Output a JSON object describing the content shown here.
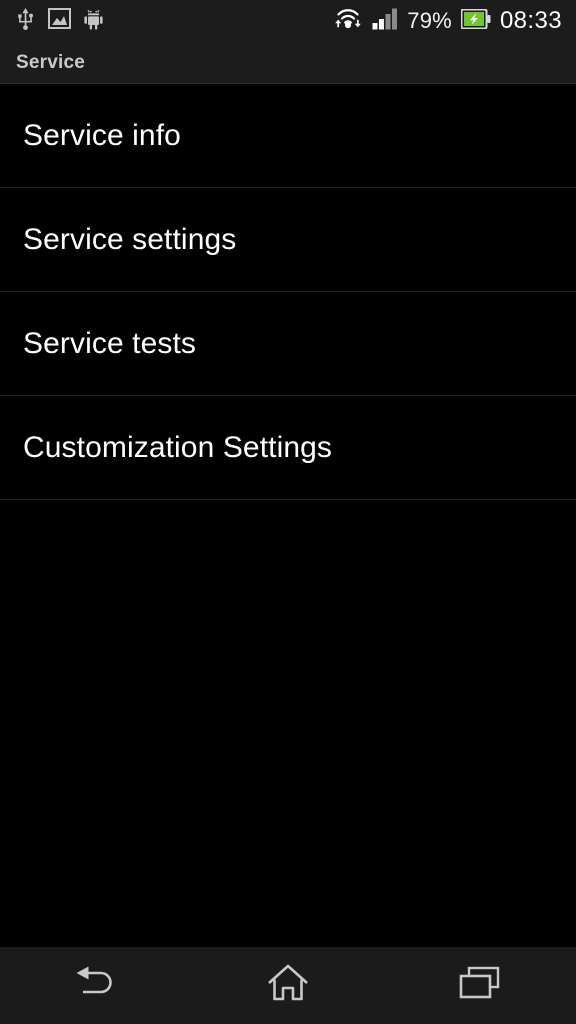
{
  "statusbar": {
    "left_icons": [
      {
        "name": "usb-icon",
        "label": "USB connected"
      },
      {
        "name": "image-icon",
        "label": "Screenshot captured"
      },
      {
        "name": "android-icon",
        "label": "Android system"
      }
    ],
    "wifi_icon": "wifi-transfer-icon",
    "signal_icon": "cellular-signal-icon",
    "signal_bars_filled": 2,
    "signal_bars_total": 4,
    "battery_percent": "79%",
    "battery_icon": "battery-charging-icon",
    "battery_color": "#6fc72e",
    "clock": "08:33"
  },
  "titlebar": {
    "title": "Service"
  },
  "list": {
    "items": [
      {
        "label": "Service info",
        "name": "list-item-service-info"
      },
      {
        "label": "Service settings",
        "name": "list-item-service-settings"
      },
      {
        "label": "Service tests",
        "name": "list-item-service-tests"
      },
      {
        "label": "Customization Settings",
        "name": "list-item-customization-settings"
      }
    ]
  },
  "navbar": {
    "back_label": "Back",
    "home_label": "Home",
    "recents_label": "Recent apps"
  },
  "colors": {
    "background": "#000000",
    "chrome": "#1c1c1c",
    "navbar": "#1b1b1b",
    "divider": "#232323",
    "text_primary": "#ffffff",
    "text_secondary": "#c9c9c9",
    "icon": "#c8c8c8"
  }
}
